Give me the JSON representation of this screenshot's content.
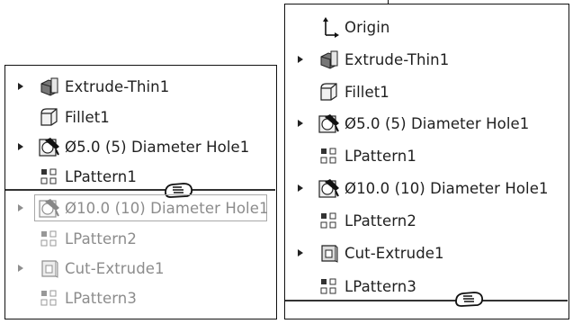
{
  "left_tree": {
    "items": [
      {
        "label": "Extrude-Thin1",
        "icon": "extrude-thin-icon",
        "expandable": true,
        "suppressed": false
      },
      {
        "label": "Fillet1",
        "icon": "fillet-icon",
        "expandable": false,
        "suppressed": false
      },
      {
        "label": "Ø5.0 (5) Diameter Hole1",
        "icon": "hole-wizard-icon",
        "expandable": true,
        "suppressed": false
      },
      {
        "label": "LPattern1",
        "icon": "linear-pattern-icon",
        "expandable": false,
        "suppressed": false
      },
      {
        "label": "Ø10.0 (10) Diameter Hole1",
        "icon": "hole-wizard-icon",
        "expandable": true,
        "suppressed": true
      },
      {
        "label": "LPattern2",
        "icon": "linear-pattern-icon",
        "expandable": false,
        "suppressed": true
      },
      {
        "label": "Cut-Extrude1",
        "icon": "cut-extrude-icon",
        "expandable": true,
        "suppressed": true
      },
      {
        "label": "LPattern3",
        "icon": "linear-pattern-icon",
        "expandable": false,
        "suppressed": true
      }
    ]
  },
  "right_tree": {
    "items": [
      {
        "label": "Origin",
        "icon": "origin-icon",
        "expandable": false
      },
      {
        "label": "Extrude-Thin1",
        "icon": "extrude-thin-icon",
        "expandable": true
      },
      {
        "label": "Fillet1",
        "icon": "fillet-icon",
        "expandable": false
      },
      {
        "label": "Ø5.0 (5) Diameter Hole1",
        "icon": "hole-wizard-icon",
        "expandable": true
      },
      {
        "label": "LPattern1",
        "icon": "linear-pattern-icon",
        "expandable": false
      },
      {
        "label": "Ø10.0 (10) Diameter Hole1",
        "icon": "hole-wizard-icon",
        "expandable": true
      },
      {
        "label": "LPattern2",
        "icon": "linear-pattern-icon",
        "expandable": false
      },
      {
        "label": "Cut-Extrude1",
        "icon": "cut-extrude-icon",
        "expandable": true
      },
      {
        "label": "LPattern3",
        "icon": "linear-pattern-icon",
        "expandable": false
      }
    ]
  },
  "colors": {
    "text": "#1f1f1f",
    "suppressed_text": "#8c8c8c",
    "border": "#111111",
    "rollback_bar": "#333333"
  }
}
